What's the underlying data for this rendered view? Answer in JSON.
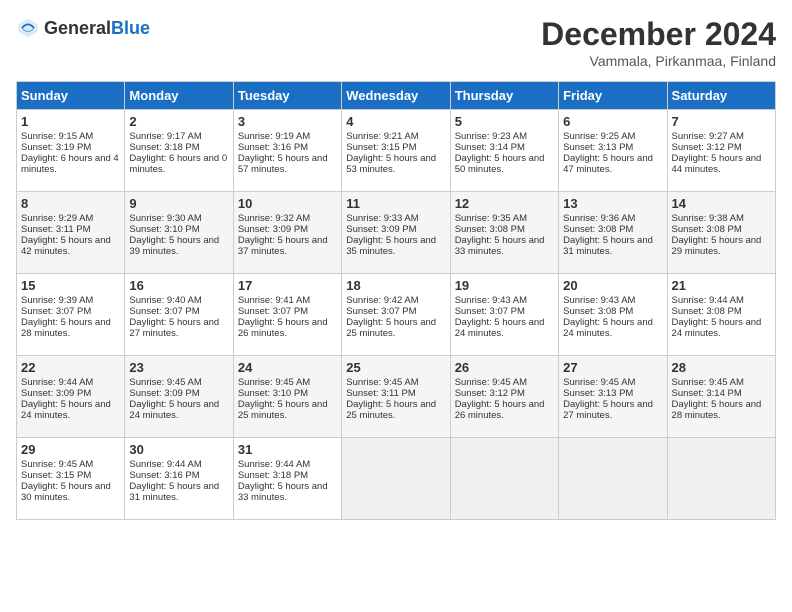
{
  "header": {
    "logo_general": "General",
    "logo_blue": "Blue",
    "month_title": "December 2024",
    "subtitle": "Vammala, Pirkanmaa, Finland"
  },
  "days_of_week": [
    "Sunday",
    "Monday",
    "Tuesday",
    "Wednesday",
    "Thursday",
    "Friday",
    "Saturday"
  ],
  "weeks": [
    [
      {
        "day": "1",
        "sunrise": "Sunrise: 9:15 AM",
        "sunset": "Sunset: 3:19 PM",
        "daylight": "Daylight: 6 hours and 4 minutes."
      },
      {
        "day": "2",
        "sunrise": "Sunrise: 9:17 AM",
        "sunset": "Sunset: 3:18 PM",
        "daylight": "Daylight: 6 hours and 0 minutes."
      },
      {
        "day": "3",
        "sunrise": "Sunrise: 9:19 AM",
        "sunset": "Sunset: 3:16 PM",
        "daylight": "Daylight: 5 hours and 57 minutes."
      },
      {
        "day": "4",
        "sunrise": "Sunrise: 9:21 AM",
        "sunset": "Sunset: 3:15 PM",
        "daylight": "Daylight: 5 hours and 53 minutes."
      },
      {
        "day": "5",
        "sunrise": "Sunrise: 9:23 AM",
        "sunset": "Sunset: 3:14 PM",
        "daylight": "Daylight: 5 hours and 50 minutes."
      },
      {
        "day": "6",
        "sunrise": "Sunrise: 9:25 AM",
        "sunset": "Sunset: 3:13 PM",
        "daylight": "Daylight: 5 hours and 47 minutes."
      },
      {
        "day": "7",
        "sunrise": "Sunrise: 9:27 AM",
        "sunset": "Sunset: 3:12 PM",
        "daylight": "Daylight: 5 hours and 44 minutes."
      }
    ],
    [
      {
        "day": "8",
        "sunrise": "Sunrise: 9:29 AM",
        "sunset": "Sunset: 3:11 PM",
        "daylight": "Daylight: 5 hours and 42 minutes."
      },
      {
        "day": "9",
        "sunrise": "Sunrise: 9:30 AM",
        "sunset": "Sunset: 3:10 PM",
        "daylight": "Daylight: 5 hours and 39 minutes."
      },
      {
        "day": "10",
        "sunrise": "Sunrise: 9:32 AM",
        "sunset": "Sunset: 3:09 PM",
        "daylight": "Daylight: 5 hours and 37 minutes."
      },
      {
        "day": "11",
        "sunrise": "Sunrise: 9:33 AM",
        "sunset": "Sunset: 3:09 PM",
        "daylight": "Daylight: 5 hours and 35 minutes."
      },
      {
        "day": "12",
        "sunrise": "Sunrise: 9:35 AM",
        "sunset": "Sunset: 3:08 PM",
        "daylight": "Daylight: 5 hours and 33 minutes."
      },
      {
        "day": "13",
        "sunrise": "Sunrise: 9:36 AM",
        "sunset": "Sunset: 3:08 PM",
        "daylight": "Daylight: 5 hours and 31 minutes."
      },
      {
        "day": "14",
        "sunrise": "Sunrise: 9:38 AM",
        "sunset": "Sunset: 3:08 PM",
        "daylight": "Daylight: 5 hours and 29 minutes."
      }
    ],
    [
      {
        "day": "15",
        "sunrise": "Sunrise: 9:39 AM",
        "sunset": "Sunset: 3:07 PM",
        "daylight": "Daylight: 5 hours and 28 minutes."
      },
      {
        "day": "16",
        "sunrise": "Sunrise: 9:40 AM",
        "sunset": "Sunset: 3:07 PM",
        "daylight": "Daylight: 5 hours and 27 minutes."
      },
      {
        "day": "17",
        "sunrise": "Sunrise: 9:41 AM",
        "sunset": "Sunset: 3:07 PM",
        "daylight": "Daylight: 5 hours and 26 minutes."
      },
      {
        "day": "18",
        "sunrise": "Sunrise: 9:42 AM",
        "sunset": "Sunset: 3:07 PM",
        "daylight": "Daylight: 5 hours and 25 minutes."
      },
      {
        "day": "19",
        "sunrise": "Sunrise: 9:43 AM",
        "sunset": "Sunset: 3:07 PM",
        "daylight": "Daylight: 5 hours and 24 minutes."
      },
      {
        "day": "20",
        "sunrise": "Sunrise: 9:43 AM",
        "sunset": "Sunset: 3:08 PM",
        "daylight": "Daylight: 5 hours and 24 minutes."
      },
      {
        "day": "21",
        "sunrise": "Sunrise: 9:44 AM",
        "sunset": "Sunset: 3:08 PM",
        "daylight": "Daylight: 5 hours and 24 minutes."
      }
    ],
    [
      {
        "day": "22",
        "sunrise": "Sunrise: 9:44 AM",
        "sunset": "Sunset: 3:09 PM",
        "daylight": "Daylight: 5 hours and 24 minutes."
      },
      {
        "day": "23",
        "sunrise": "Sunrise: 9:45 AM",
        "sunset": "Sunset: 3:09 PM",
        "daylight": "Daylight: 5 hours and 24 minutes."
      },
      {
        "day": "24",
        "sunrise": "Sunrise: 9:45 AM",
        "sunset": "Sunset: 3:10 PM",
        "daylight": "Daylight: 5 hours and 25 minutes."
      },
      {
        "day": "25",
        "sunrise": "Sunrise: 9:45 AM",
        "sunset": "Sunset: 3:11 PM",
        "daylight": "Daylight: 5 hours and 25 minutes."
      },
      {
        "day": "26",
        "sunrise": "Sunrise: 9:45 AM",
        "sunset": "Sunset: 3:12 PM",
        "daylight": "Daylight: 5 hours and 26 minutes."
      },
      {
        "day": "27",
        "sunrise": "Sunrise: 9:45 AM",
        "sunset": "Sunset: 3:13 PM",
        "daylight": "Daylight: 5 hours and 27 minutes."
      },
      {
        "day": "28",
        "sunrise": "Sunrise: 9:45 AM",
        "sunset": "Sunset: 3:14 PM",
        "daylight": "Daylight: 5 hours and 28 minutes."
      }
    ],
    [
      {
        "day": "29",
        "sunrise": "Sunrise: 9:45 AM",
        "sunset": "Sunset: 3:15 PM",
        "daylight": "Daylight: 5 hours and 30 minutes."
      },
      {
        "day": "30",
        "sunrise": "Sunrise: 9:44 AM",
        "sunset": "Sunset: 3:16 PM",
        "daylight": "Daylight: 5 hours and 31 minutes."
      },
      {
        "day": "31",
        "sunrise": "Sunrise: 9:44 AM",
        "sunset": "Sunset: 3:18 PM",
        "daylight": "Daylight: 5 hours and 33 minutes."
      },
      null,
      null,
      null,
      null
    ]
  ]
}
